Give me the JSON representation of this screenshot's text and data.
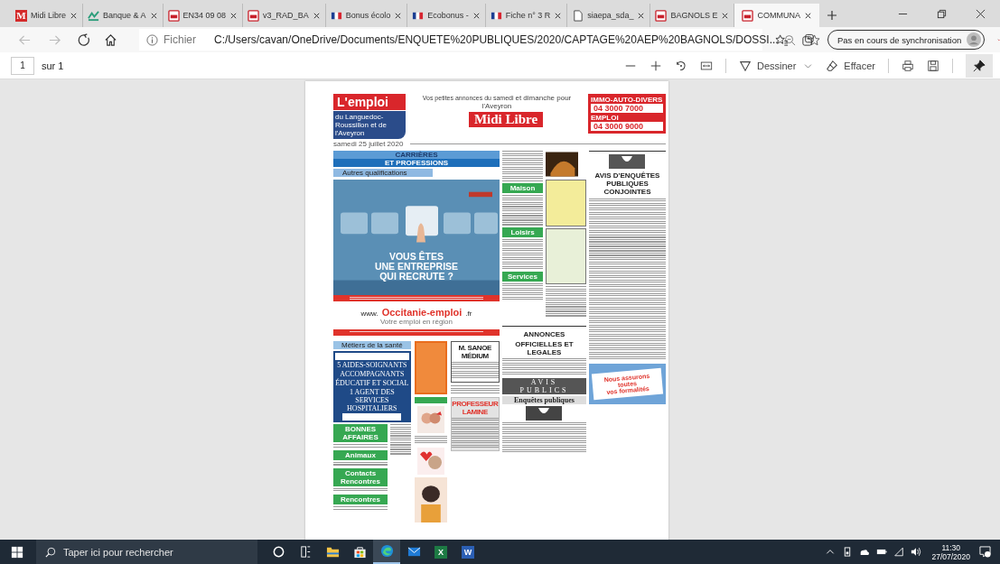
{
  "tabs": [
    {
      "title": "Midi Libre",
      "kind": "letter",
      "badge": "M",
      "selected": false
    },
    {
      "title": "Banque & A",
      "kind": "bank",
      "selected": false
    },
    {
      "title": "EN34 09 08",
      "kind": "pdf",
      "selected": false
    },
    {
      "title": "v3_RAD_BA",
      "kind": "pdf",
      "selected": false
    },
    {
      "title": "Bonus écolo",
      "kind": "flag",
      "selected": false
    },
    {
      "title": "Ecobonus -",
      "kind": "flag",
      "selected": false
    },
    {
      "title": "Fiche n° 3 R",
      "kind": "flag",
      "selected": false
    },
    {
      "title": "siaepa_sda_",
      "kind": "page",
      "selected": false
    },
    {
      "title": "BAGNOLS E",
      "kind": "pdf",
      "selected": false
    },
    {
      "title": "COMMUNA",
      "kind": "pdf",
      "selected": true
    }
  ],
  "address_bar": {
    "scheme": "Fichier",
    "url": "C:/Users/cavan/OneDrive/Documents/ENQUETE%20PUBLIQUES/2020/CAPTAGE%20AEP%20BAGNOLS/DOSSI..."
  },
  "profile": {
    "label": "Pas en cours de synchronisation"
  },
  "pdf_toolbar": {
    "page": "1",
    "of": "sur 1",
    "draw": "Dessiner",
    "erase": "Effacer"
  },
  "newspaper": {
    "logo": "L'emploi",
    "logo_sub": "du Languedoc-Roussillon et de l'Aveyron",
    "tagline": "Vos petites annonces du samedi",
    "tagline_small": "et dimanche pour l'Aveyron",
    "masthead": "Midi Libre",
    "date": "samedi 25 juillet 2020",
    "phones": [
      {
        "label": "IMMO-AUTO-DIVERS",
        "number": "04 3000 7000"
      },
      {
        "label": "EMPLOI",
        "number": "04 3000 9000"
      }
    ],
    "section_title": "CARRIÈRES",
    "section_subtitle": "ET PROFESSIONS",
    "subsection": "Autres qualifications",
    "ad_headline": [
      "VOUS ÊTES",
      "UNE ENTREPRISE",
      "QUI RECRUTE ?"
    ],
    "site": {
      "prefix": "www.",
      "name": "Occitanie-emploi",
      "suffix": ".fr",
      "slogan": "Votre emploi en région"
    },
    "health": {
      "heading": "Métiers de la santé",
      "lines": [
        "5 AIDES-SOIGNANTS",
        "ACCOMPAGNANTS",
        "ÉDUCATIF ET SOCIAL",
        "1 AGENT DES SERVICES HOSPITALIERS"
      ]
    },
    "left_headings": [
      "BONNES AFFAIRES",
      "Animaux",
      "Contacts Rencontres",
      "Rencontres"
    ],
    "ads": [
      "M. SANOE MÉDIUM",
      "PROFESSEUR LAMINE"
    ],
    "mid_headings": [
      "Maison",
      "Loisirs",
      "Services"
    ],
    "official": {
      "title": [
        "ANNONCES",
        "OFFICIELLES ET LEGALES"
      ],
      "avis": [
        "AVIS",
        "PUBLICS"
      ],
      "enquetes": "Enquêtes publiques"
    },
    "notice_title": "AVIS D'ENQUÊTES PUBLIQUES CONJOINTES",
    "stamp": [
      "Nous assurons",
      "toutes",
      "vos formalités"
    ]
  },
  "taskbar": {
    "search_placeholder": "Taper ici pour rechercher",
    "apps": [
      {
        "kind": "cortana",
        "selected": false
      },
      {
        "kind": "taskview",
        "selected": false
      },
      {
        "kind": "explorer",
        "selected": false
      },
      {
        "kind": "store",
        "selected": false
      },
      {
        "kind": "edge",
        "selected": true
      },
      {
        "kind": "mail",
        "selected": false
      },
      {
        "kind": "excel",
        "letter": "X",
        "selected": false
      },
      {
        "kind": "word",
        "letter": "W",
        "selected": false
      }
    ],
    "time": "11:30",
    "date": "27/07/2020"
  }
}
